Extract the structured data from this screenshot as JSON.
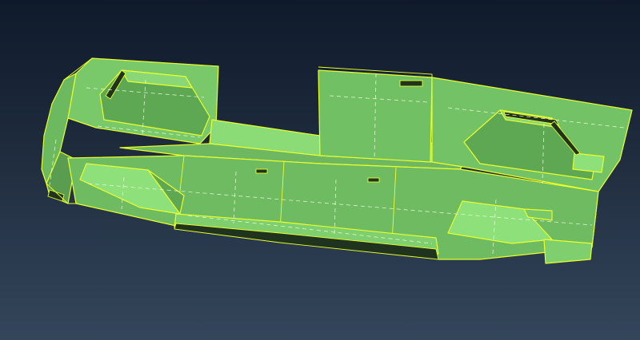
{
  "viewport": {
    "background_top": "#0f1a2b",
    "background_bottom": "#34465b",
    "model_face_color": "#73c265",
    "model_face_dark": "#5c9f53",
    "model_face_light": "#8ee07a",
    "edge_color": "#e8ff2a",
    "hidden_edge_color": "#f2ffe2",
    "render_mode": "shaded-with-edges"
  }
}
